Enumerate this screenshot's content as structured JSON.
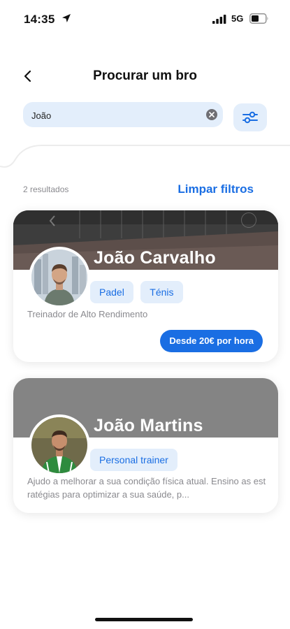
{
  "status_bar": {
    "time": "14:35",
    "network": "5G"
  },
  "header": {
    "title": "Procurar um bro"
  },
  "search": {
    "value": "João"
  },
  "results": {
    "count_label": "2 resultados",
    "clear_filters_label": "Limpar filtros"
  },
  "cards": [
    {
      "name": "João Carvalho",
      "tags": [
        "Padel",
        "Ténis"
      ],
      "description": "Treinador de Alto Rendimento",
      "price_label": "Desde 20€ por hora"
    },
    {
      "name": "João Martins",
      "tags": [
        "Personal trainer"
      ],
      "description": "Ajudo a melhorar a sua condição física atual. Ensino as estratégias para optimizar a sua saúde, p..."
    }
  ],
  "colors": {
    "accent": "#1a6ee3",
    "chip_bg": "#e3eefb",
    "muted_text": "#8a8a8f"
  },
  "icons": [
    "location-arrow-icon",
    "signal-icon",
    "battery-icon",
    "back-chevron-icon",
    "clear-icon",
    "filter-icon"
  ]
}
